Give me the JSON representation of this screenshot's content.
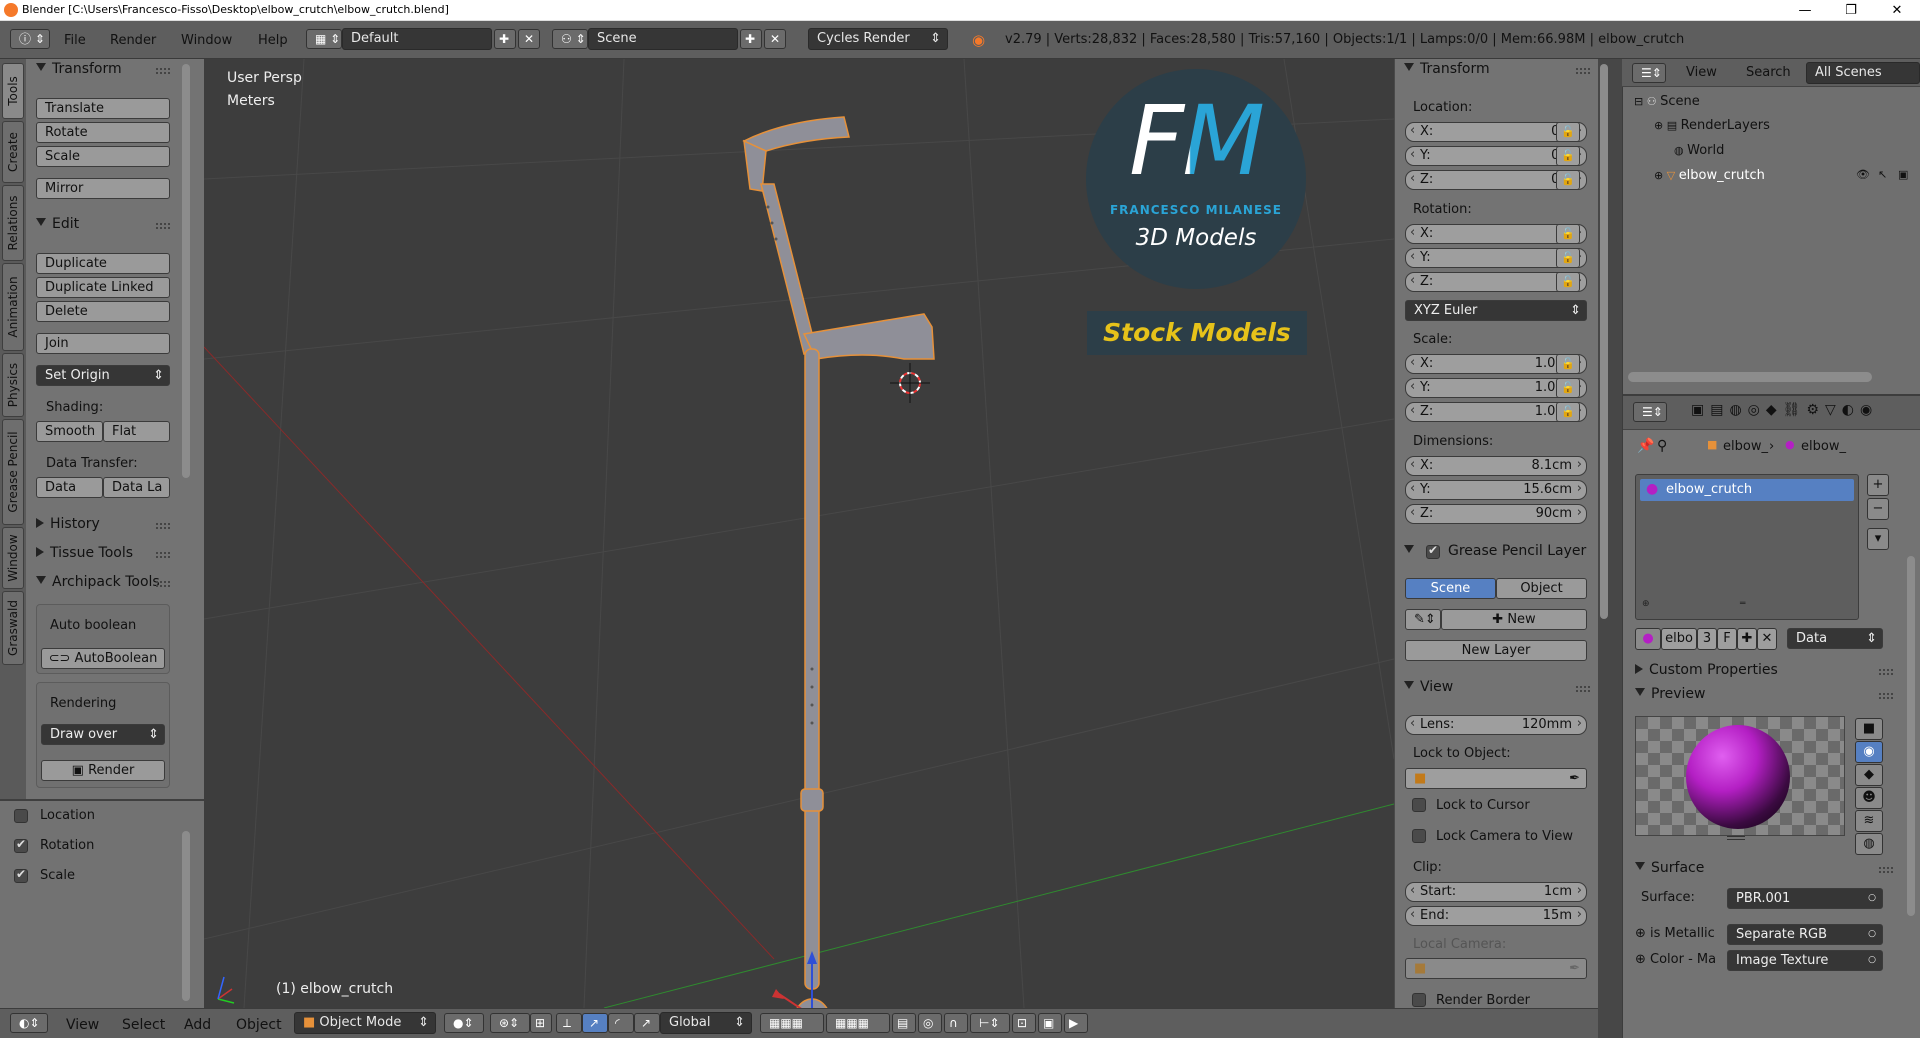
{
  "window": {
    "title": "Blender [C:\\Users\\Francesco-Fisso\\Desktop\\elbow_crutch\\elbow_crutch.blend]",
    "minimize": "—",
    "maximize": "❐",
    "close": "✕"
  },
  "info_bar": {
    "menus": [
      "File",
      "Render",
      "Window",
      "Help"
    ],
    "layout": "Default",
    "scene": "Scene",
    "render_engine": "Cycles Render",
    "stats": "v2.79 | Verts:28,832 | Faces:28,580 | Tris:57,160 | Objects:1/1 | Lamps:0/0 | Mem:66.98M | elbow_crutch"
  },
  "vertical_tabs": [
    "Tools",
    "Create",
    "Relations",
    "Animation",
    "Physics",
    "Grease Pencil",
    "Window",
    "Graswald"
  ],
  "tool_shelf": {
    "transform_title": "Transform",
    "translate": "Translate",
    "rotate": "Rotate",
    "scale": "Scale",
    "mirror": "Mirror",
    "edit_title": "Edit",
    "duplicate": "Duplicate",
    "duplicate_linked": "Duplicate Linked",
    "delete": "Delete",
    "join": "Join",
    "set_origin": "Set Origin",
    "shading_label": "Shading:",
    "smooth": "Smooth",
    "flat": "Flat",
    "data_transfer_label": "Data Transfer:",
    "data": "Data",
    "data_layout": "Data La",
    "history": "History",
    "tissue_tools": "Tissue Tools",
    "archipack": "Archipack Tools",
    "auto_boolean_label": "Auto boolean",
    "auto_boolean_btn": "AutoBoolean",
    "rendering_label": "Rendering",
    "draw_over": "Draw over",
    "render": "Render"
  },
  "operator": {
    "location": "Location",
    "rotation": "Rotation",
    "scale": "Scale",
    "location_checked": false,
    "rotation_checked": true,
    "scale_checked": true
  },
  "viewport": {
    "view_name": "User Persp",
    "units": "Meters",
    "object_label": "(1) elbow_crutch",
    "logo_letters": "FM",
    "logo_name": "FRANCESCO MILANESE",
    "logo_sub": "3D Models",
    "stock_label": "Stock Models"
  },
  "n_panel": {
    "transform_title": "Transform",
    "location_label": "Location:",
    "loc": [
      {
        "axis": "X:",
        "value": "0m"
      },
      {
        "axis": "Y:",
        "value": "0m"
      },
      {
        "axis": "Z:",
        "value": "0m"
      }
    ],
    "rotation_label": "Rotation:",
    "rot": [
      {
        "axis": "X:",
        "value": "0°"
      },
      {
        "axis": "Y:",
        "value": "0°"
      },
      {
        "axis": "Z:",
        "value": "0°"
      }
    ],
    "rotation_mode": "XYZ Euler",
    "scale_label": "Scale:",
    "scl": [
      {
        "axis": "X:",
        "value": "1.000"
      },
      {
        "axis": "Y:",
        "value": "1.000"
      },
      {
        "axis": "Z:",
        "value": "1.000"
      }
    ],
    "dimensions_label": "Dimensions:",
    "dim": [
      {
        "axis": "X:",
        "value": "8.1cm"
      },
      {
        "axis": "Y:",
        "value": "15.6cm"
      },
      {
        "axis": "Z:",
        "value": "90cm"
      }
    ],
    "grease_pencil_title": "Grease Pencil Layer",
    "gp_scene": "Scene",
    "gp_object": "Object",
    "gp_new": "New",
    "gp_new_layer": "New Layer",
    "view_title": "View",
    "lens_label": "Lens:",
    "lens_value": "120mm",
    "lock_to_object": "Lock to Object:",
    "lock_to_cursor": "Lock to Cursor",
    "lock_camera": "Lock Camera to View",
    "clip_label": "Clip:",
    "clip_start_label": "Start:",
    "clip_start": "1cm",
    "clip_end_label": "End:",
    "clip_end": "15m",
    "local_camera": "Local Camera:",
    "render_border": "Render Border"
  },
  "outliner": {
    "view": "View",
    "search": "Search",
    "filter": "All Scenes",
    "items": [
      "Scene",
      "RenderLayers",
      "World",
      "elbow_crutch"
    ]
  },
  "properties": {
    "crumb1": "elbow_",
    "crumb2": "elbow_",
    "material_slot": "elbow_crutch",
    "mat_short": "elbo",
    "mat_users": "3",
    "mat_fake": "F",
    "mat_link": "Data",
    "custom_properties": "Custom Properties",
    "preview": "Preview",
    "surface_title": "Surface",
    "surface_label": "Surface:",
    "surface_value": "PBR.001",
    "is_metallic_label": "is Metallic",
    "is_metallic_value": "Separate RGB",
    "color_label": "Color - Ma",
    "color_value": "Image Texture"
  },
  "bottom_bar": {
    "view": "View",
    "select": "Select",
    "add": "Add",
    "object": "Object",
    "mode": "Object Mode",
    "orientation": "Global"
  },
  "colors": {
    "accent_blue": "#5680c2",
    "logo_bg": "#2c3e48",
    "logo_cyan": "#2aa4d6",
    "stock_yellow": "#e6c21a",
    "material_magenta": "#b41fc4"
  }
}
